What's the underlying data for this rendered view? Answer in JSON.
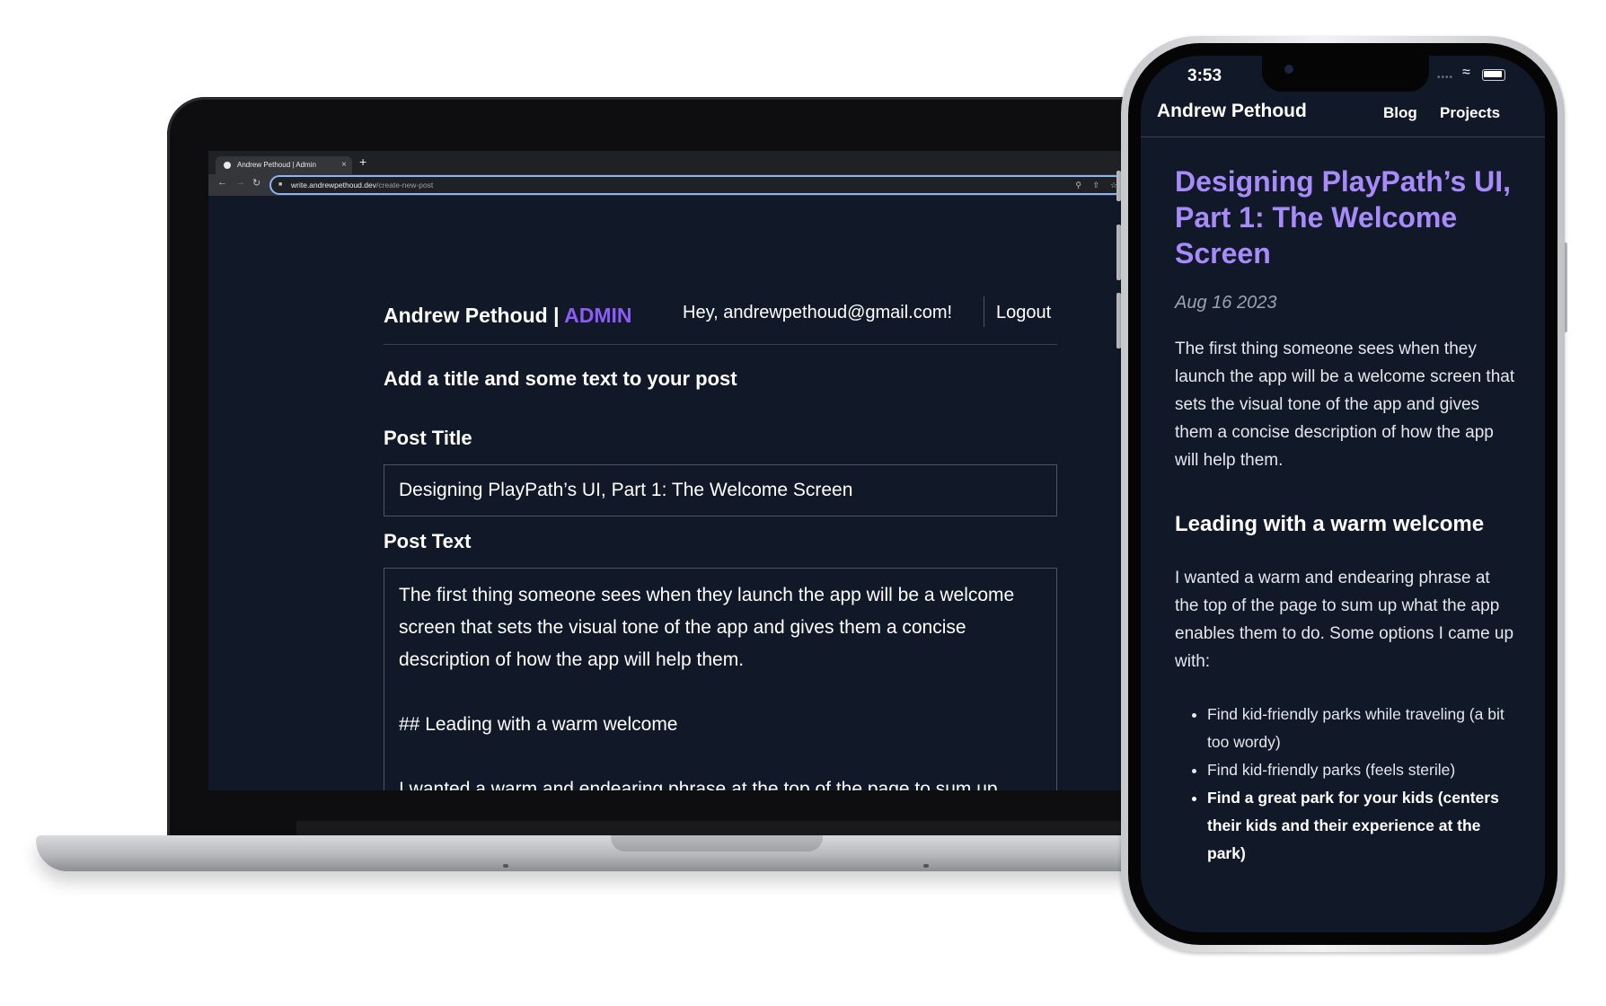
{
  "browser": {
    "tab_title": "Andrew Pethoud | Admin",
    "tab_close": "×",
    "new_tab": "+",
    "url_host": "write.andrewpethoud.dev",
    "url_path": "/create-new-post",
    "icons": [
      "back-arrow-icon",
      "forward-arrow-icon",
      "reload-icon",
      "lock-icon",
      "zoom-icon",
      "share-icon",
      "bookmark-star-icon"
    ]
  },
  "admin": {
    "brand_name": "Andrew Pethoud",
    "brand_separator": " | ",
    "brand_tag": "ADMIN",
    "greeting": "Hey, andrewpethoud@gmail.com!",
    "logout_label": "Logout",
    "subheading": "Add a title and some text to your post",
    "post_title_label": "Post Title",
    "post_title_value": "Designing PlayPath’s UI, Part 1: The Welcome Screen",
    "post_text_label": "Post Text",
    "post_text_value": "The first thing someone sees when they launch the app will be a welcome screen that sets the visual tone of the app and gives them a concise description of how the app will help them.\n\n## Leading with a warm welcome\n\nI wanted a warm and endearing phrase at the top of the page to sum up what",
    "accent_color": "#8b5cf6"
  },
  "phone": {
    "status_time": "3:53",
    "brand_name": "Andrew Pethoud",
    "nav": [
      "Blog",
      "Projects"
    ],
    "post_title": "Designing PlayPath’s UI, Part 1: The Welcome Screen",
    "post_date": "Aug 16 2023",
    "paragraph1": "The first thing someone sees when they launch the app will be a welcome screen that sets the visual tone of the app and gives them a concise description of how the app will help them.",
    "heading2": "Leading with a warm welcome",
    "paragraph2": "I wanted a warm and endearing phrase at the top of the page to sum up what the app enables them to do. Some options I came up with:",
    "list_items": [
      "Find kid-friendly parks while traveling (a bit too wordy)",
      "Find kid-friendly parks (feels sterile)",
      "Find a great park for your kids (centers their kids and their experience at the park)"
    ],
    "title_color": "#a78bfa",
    "background_color": "#111827"
  }
}
